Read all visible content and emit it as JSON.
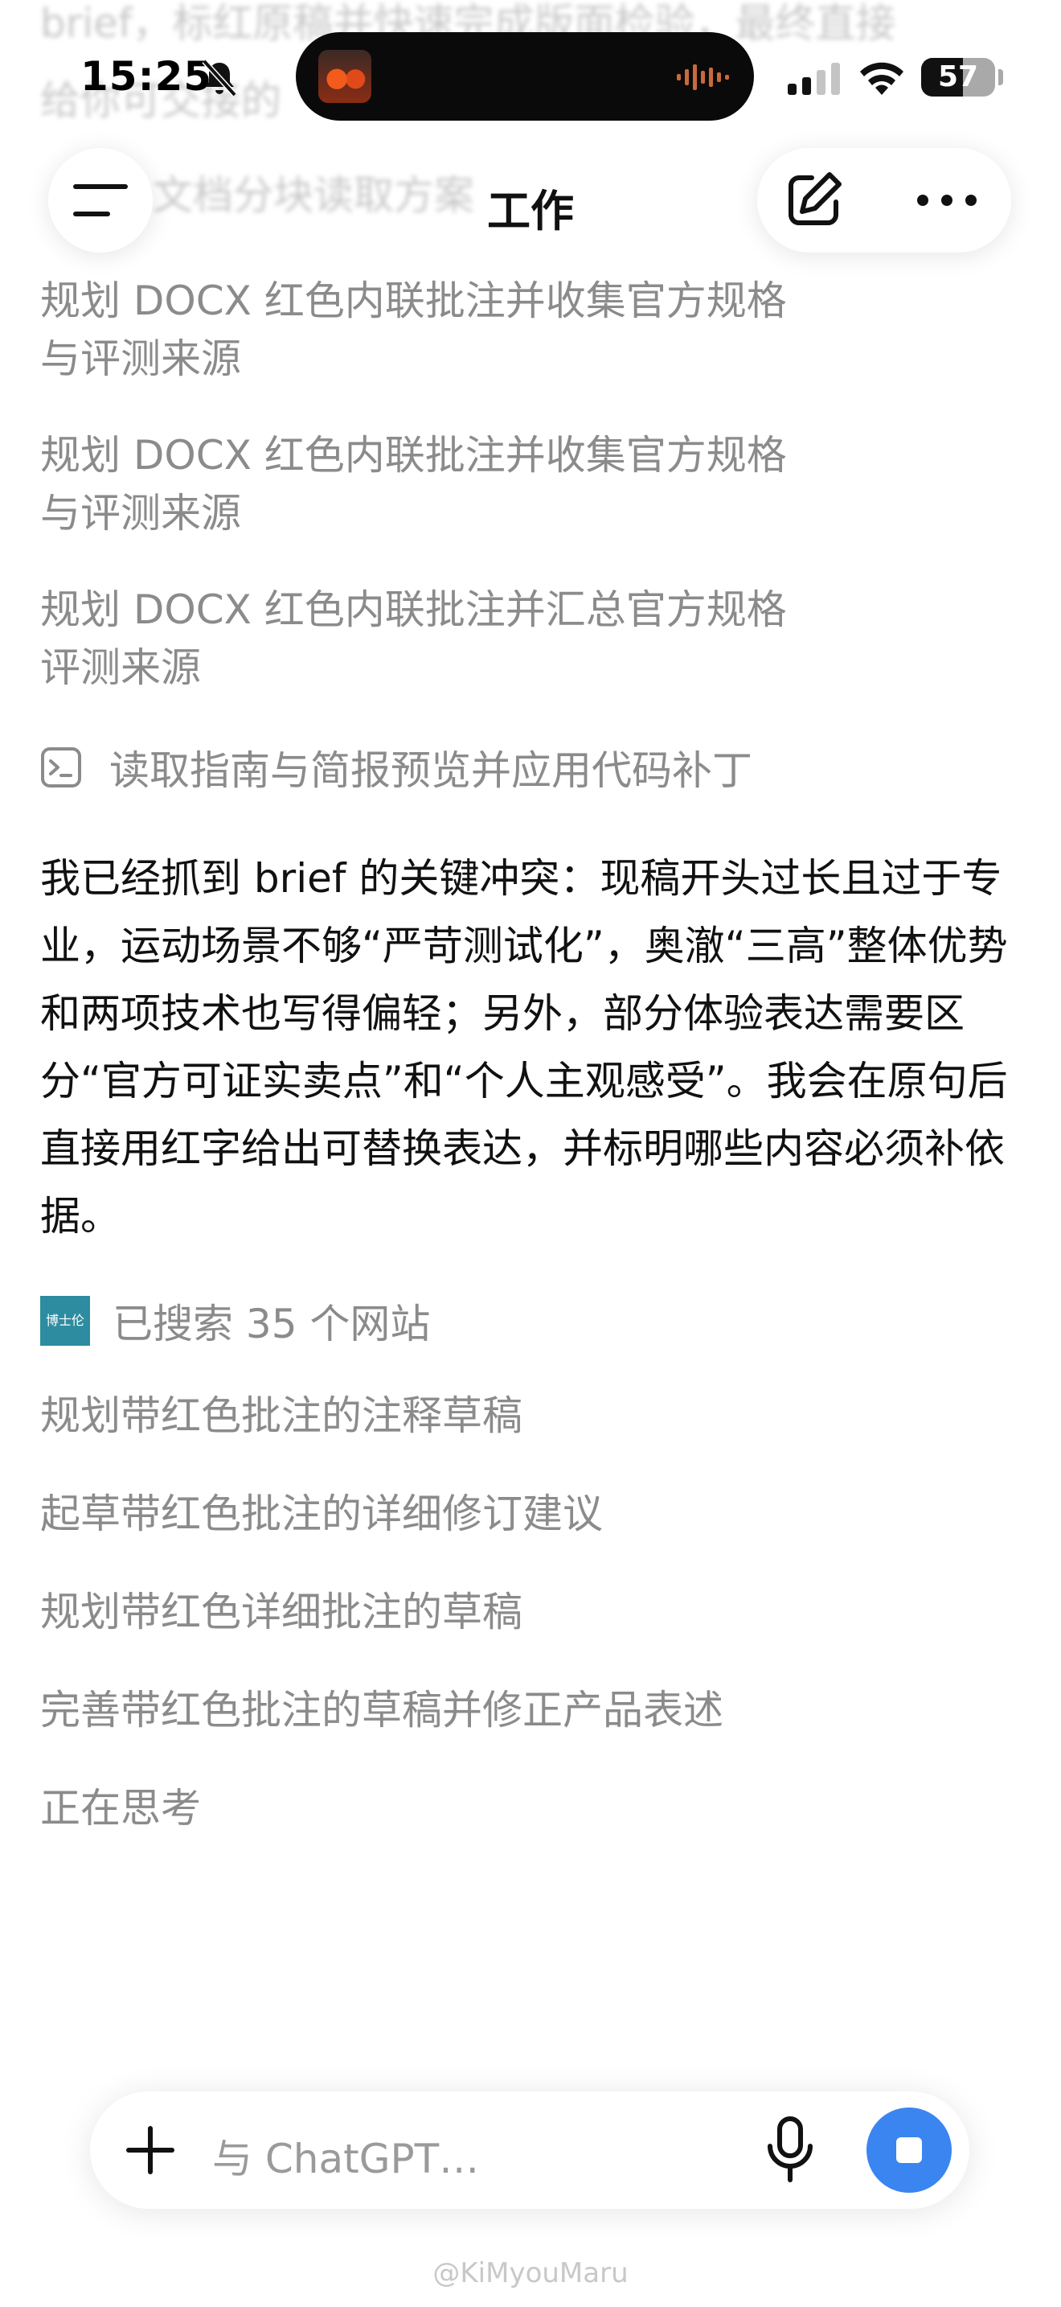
{
  "status_bar": {
    "time": "15:25",
    "battery_percent": "57",
    "battery_level": 0.57
  },
  "background_text": {
    "line1": "brief，标红原稿并快速完成版面检验，最终直接",
    "line2": "给你可交接的",
    "line3": "文档分块读取方案"
  },
  "header": {
    "title": "工作"
  },
  "steps": [
    "规划 DOCX 红色内联批注并收集官方规格\n与评测来源",
    "规划 DOCX 红色内联批注并收集官方规格\n与评测来源",
    "规划 DOCX 红色内联批注并汇总官方规格\n评测来源"
  ],
  "tool_step": {
    "icon": "terminal-icon",
    "label": "读取指南与简报预览并应用代码补丁"
  },
  "message": "我已经抓到 brief 的关键冲突：现稿开头过长且过于专业，运动场景不够“严苛测试化”，奥澈“三高”整体优势和两项技术也写得偏轻；另外，部分体验表达需要区分“官方可证实卖点”和“个人主观感受”。我会在原句后直接用红字给出可替换表达，并标明哪些内容必须补依据。",
  "search_step": {
    "site_icon_text": "博士伦",
    "label": "已搜索 35 个网站"
  },
  "steps2": [
    "规划带红色批注的注释草稿",
    "起草带红色批注的详细修订建议",
    "规划带红色详细批注的草稿",
    "完善带红色批注的草稿并修正产品表述",
    "正在思考"
  ],
  "composer": {
    "placeholder": "与 ChatGPT…"
  },
  "watermark": "@KiMyouMaru",
  "colors": {
    "accent_blue": "#3a85f0",
    "step_gray": "#8b8b8b"
  }
}
